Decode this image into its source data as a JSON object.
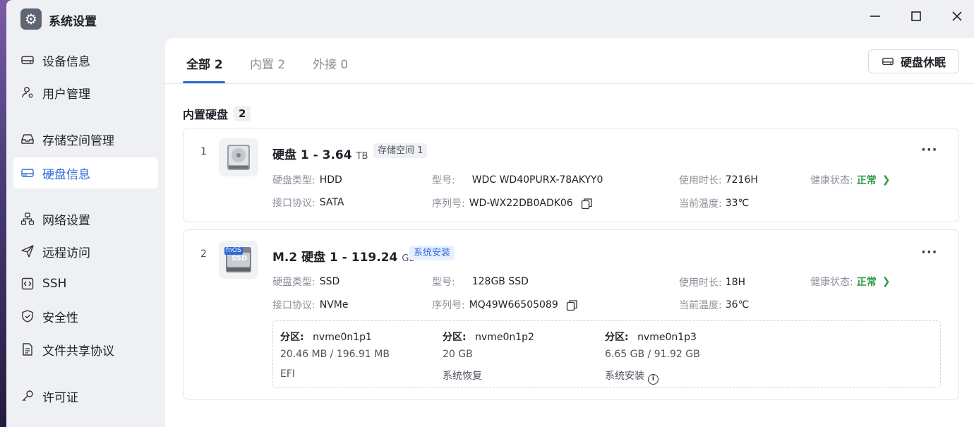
{
  "window": {
    "title": "系统设置",
    "minimize_icon": "minimize-icon",
    "maximize_icon": "maximize-icon",
    "close_icon": "close-icon"
  },
  "sidebar": {
    "items": [
      {
        "label": "设备信息",
        "icon": "device-icon"
      },
      {
        "label": "用户管理",
        "icon": "user-icon"
      },
      {
        "label": "存储空间管理",
        "icon": "storage-icon"
      },
      {
        "label": "硬盘信息",
        "icon": "disk-icon",
        "active": true
      },
      {
        "label": "网络设置",
        "icon": "network-icon"
      },
      {
        "label": "远程访问",
        "icon": "send-icon"
      },
      {
        "label": "SSH",
        "icon": "code-icon"
      },
      {
        "label": "安全性",
        "icon": "shield-icon"
      },
      {
        "label": "文件共享协议",
        "icon": "file-icon"
      },
      {
        "label": "许可证",
        "icon": "key-icon"
      }
    ]
  },
  "tabs": [
    {
      "label": "全部 2",
      "active": true
    },
    {
      "label": "内置 2"
    },
    {
      "label": "外接 0"
    }
  ],
  "sleep_button": {
    "label": "硬盘休眠"
  },
  "section": {
    "title": "内置硬盘",
    "count": "2"
  },
  "disks": [
    {
      "index": "1",
      "name": "硬盘 1 - 3.64",
      "unit": "TB",
      "tag": "存储空间 1",
      "type_label": "硬盘类型:",
      "type": "HDD",
      "interface_label": "接口协议:",
      "interface": "SATA",
      "model_label": "型号:",
      "model": "WDC WD40PURX-78AKYY0",
      "serial_label": "序列号:",
      "serial": "WD-WX22DB0ADK06",
      "usage_label": "使用时长:",
      "usage": "7216H",
      "temp_label": "当前温度:",
      "temp": "33℃",
      "health_label": "健康状态:",
      "health": "正常"
    },
    {
      "index": "2",
      "name": "M.2 硬盘 1 - 119.24",
      "unit": "GB",
      "tag": "系统安装",
      "badge_brand": "fnOS",
      "badge_type": "SSD",
      "type_label": "硬盘类型:",
      "type": "SSD",
      "interface_label": "接口协议:",
      "interface": "NVMe",
      "model_label": "型号:",
      "model": "128GB SSD",
      "serial_label": "序列号:",
      "serial": "MQ49W66505089",
      "usage_label": "使用时长:",
      "usage": "18H",
      "temp_label": "当前温度:",
      "temp": "36℃",
      "health_label": "健康状态:",
      "health": "正常",
      "partitions": [
        {
          "label": "分区:",
          "name": "nvme0n1p1",
          "size": "20.46 MB / 196.91 MB",
          "desc": "EFI"
        },
        {
          "label": "分区:",
          "name": "nvme0n1p2",
          "size": "20 GB",
          "desc": "系统恢复"
        },
        {
          "label": "分区:",
          "name": "nvme0n1p3",
          "size": "6.65 GB / 91.92 GB",
          "desc": "系统安装"
        }
      ]
    }
  ],
  "more_label": "···"
}
